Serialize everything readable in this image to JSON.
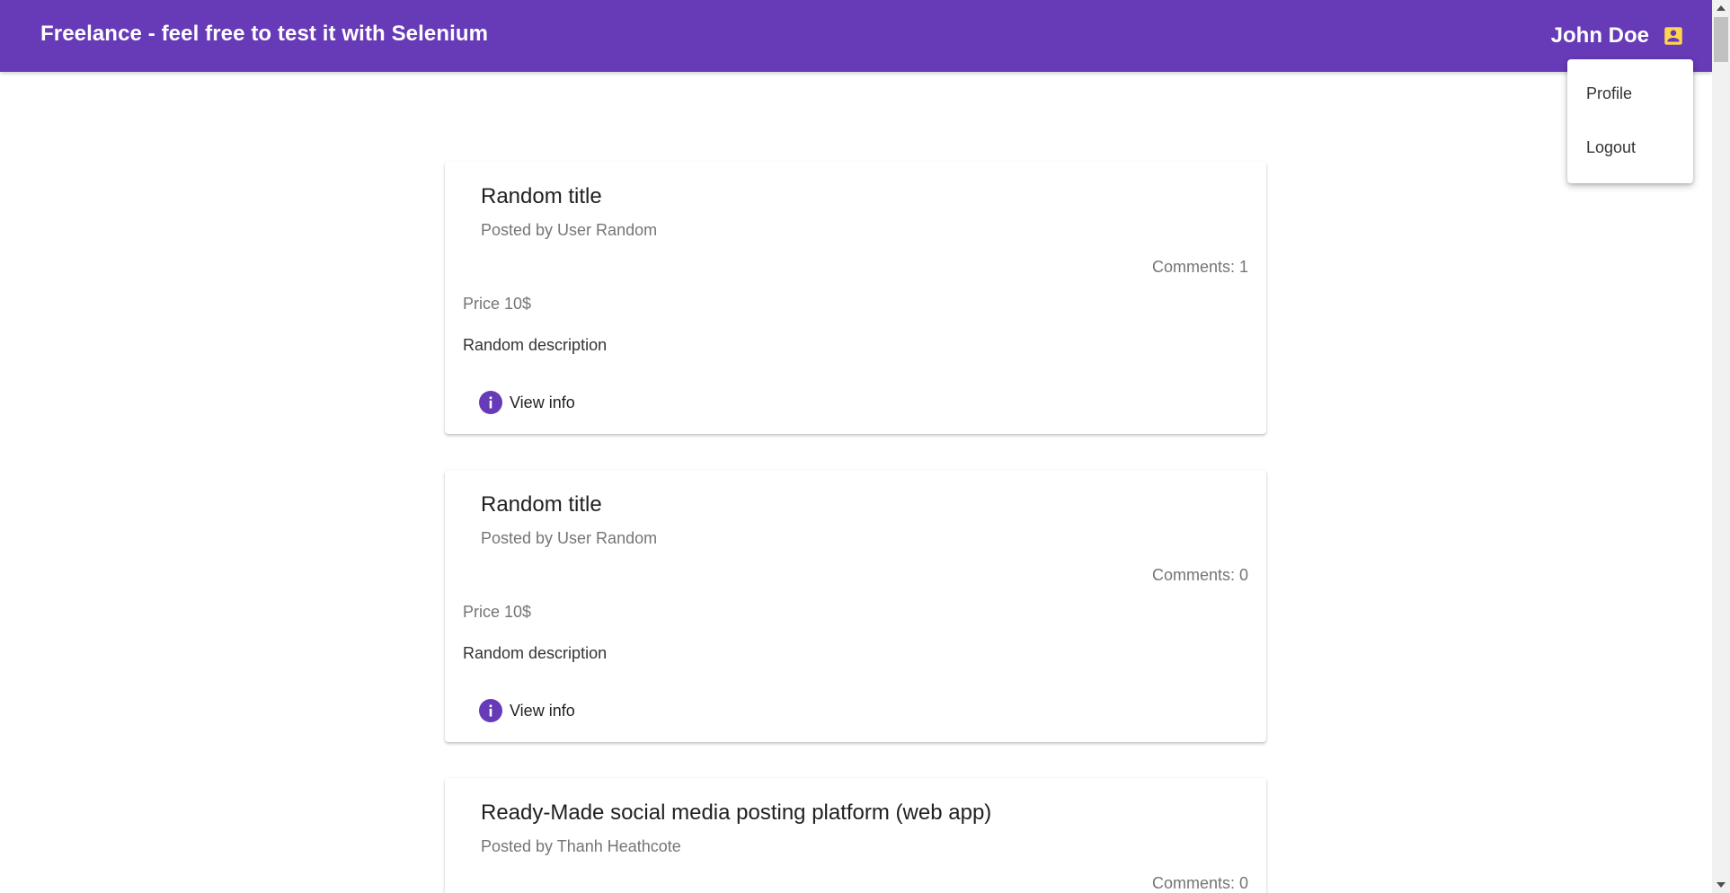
{
  "header": {
    "title": "Freelance - feel free to test it with Selenium",
    "user_name": "John Doe",
    "user_icon": "account-box-icon"
  },
  "user_menu": {
    "items": [
      {
        "label": "Profile"
      },
      {
        "label": "Logout"
      }
    ]
  },
  "jobs": [
    {
      "title": "Random title",
      "posted_by": "Posted by User Random",
      "comments": "Comments: 1",
      "price": "Price 10$",
      "description": "Random description",
      "action_label": "View info"
    },
    {
      "title": "Random title",
      "posted_by": "Posted by User Random",
      "comments": "Comments: 0",
      "price": "Price 10$",
      "description": "Random description",
      "action_label": "View info"
    },
    {
      "title": "Ready-Made social media posting platform (web app)",
      "posted_by": "Posted by Thanh Heathcote",
      "comments": "Comments: 0",
      "price": "",
      "description": "",
      "action_label": ""
    }
  ],
  "colors": {
    "primary": "#673ab7",
    "user_icon": "#ffd54f"
  }
}
